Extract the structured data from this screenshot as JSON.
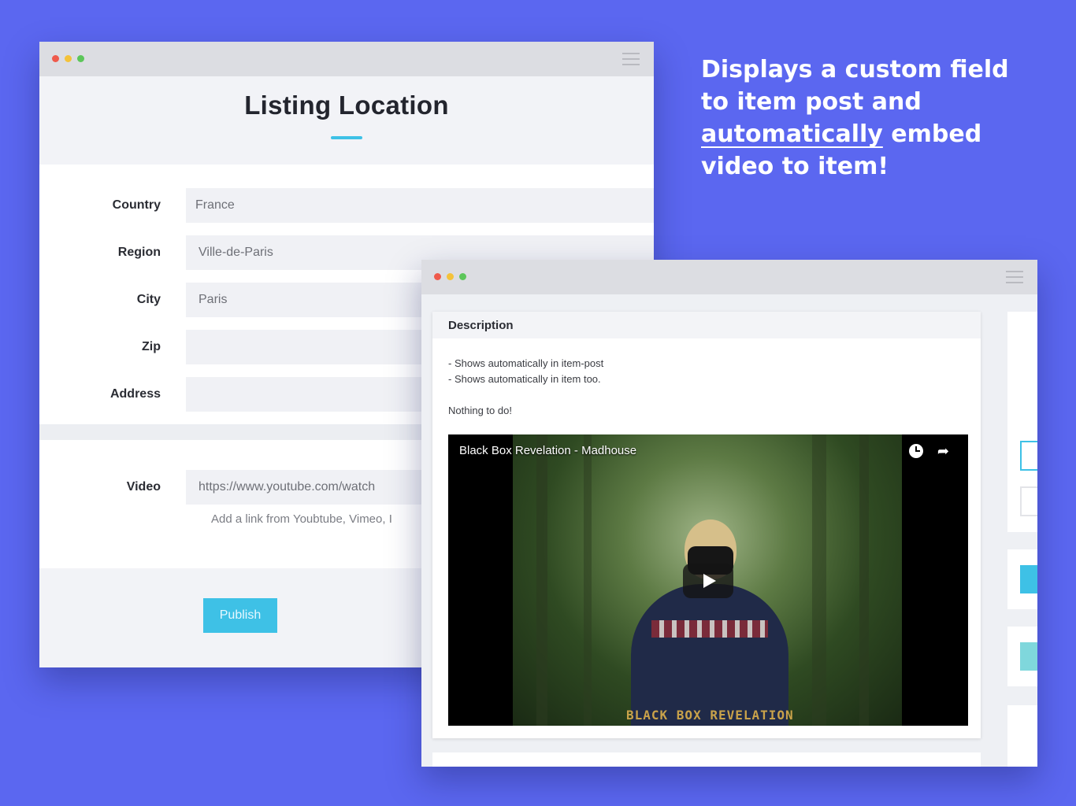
{
  "listing_window": {
    "title": "Listing Location",
    "fields": [
      {
        "label": "Country",
        "value": "France"
      },
      {
        "label": "Region",
        "value": "Ville-de-Paris"
      },
      {
        "label": "City",
        "value": "Paris"
      },
      {
        "label": "Zip",
        "value": ""
      },
      {
        "label": "Address",
        "value": ""
      }
    ],
    "video": {
      "label": "Video",
      "value": "https://www.youtube.com/watch",
      "help": "Add a link from Youbtube, Vimeo, I"
    },
    "publish_label": "Publish"
  },
  "headline": {
    "line1": "Displays a custom field",
    "line2": "to item post and",
    "line3_underlined": "automatically",
    "line3_rest": " embed",
    "line4": "video to item!"
  },
  "description_window": {
    "heading": "Description",
    "lines": [
      "- Shows automatically in item-post",
      "- Shows automatically in item too."
    ],
    "note": "Nothing to do!",
    "video_title": "Black Box Revelation - Madhouse",
    "video_caption": "BLACK BOX REVELATION",
    "share_glyph": "➦"
  },
  "colors": {
    "background": "#5b67f0",
    "accent": "#3ec1e6"
  }
}
